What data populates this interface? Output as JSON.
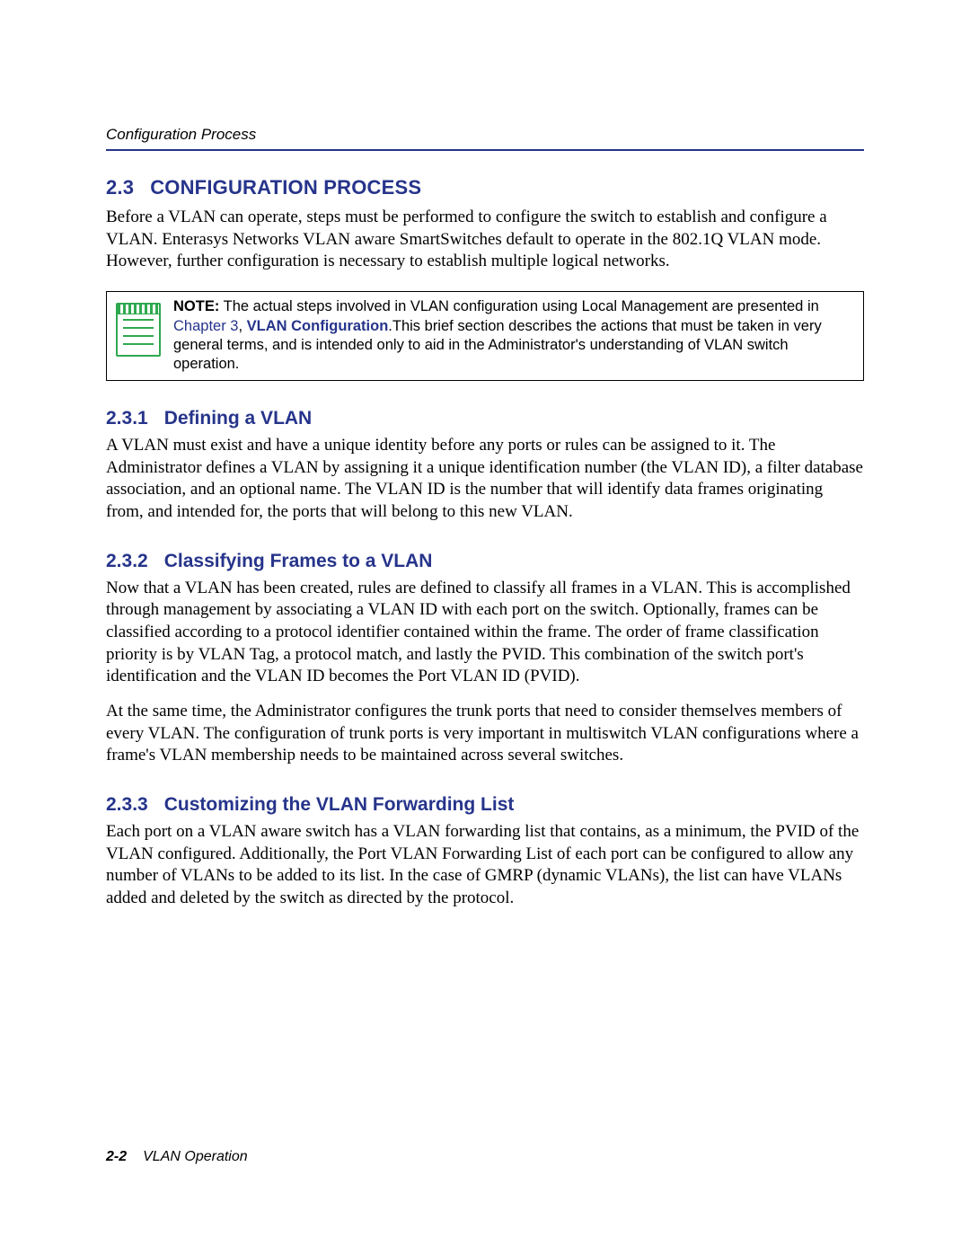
{
  "runningHead": "Configuration Process",
  "section": {
    "num": "2.3",
    "title": "CONFIGURATION PROCESS",
    "intro": "Before a VLAN can operate, steps must be performed to configure the switch to establish and configure a VLAN. Enterasys Networks VLAN aware SmartSwitches default to operate in the 802.1Q VLAN mode. However, further configuration is necessary to establish multiple logical networks."
  },
  "note": {
    "label": "NOTE:",
    "pre": " The actual steps involved in VLAN configuration using Local Management are presented in ",
    "link1": "Chapter 3",
    "sep": ", ",
    "link2": "VLAN Configuration",
    "post": ".This brief section describes the actions that must be taken in very general terms, and is intended only to aid in the Administrator's understanding of VLAN switch operation."
  },
  "sub1": {
    "num": "2.3.1",
    "title": "Defining a VLAN",
    "body": "A VLAN must exist and have a unique identity before any ports or rules can be assigned to it. The Administrator defines a VLAN by assigning it a unique identification number (the VLAN ID), a filter database association, and an optional name. The VLAN ID is the number that will identify data frames originating from, and intended for, the ports that will belong to this new VLAN."
  },
  "sub2": {
    "num": "2.3.2",
    "title": "Classifying Frames to a VLAN",
    "body1": "Now that a VLAN has been created, rules are defined to classify all frames in a VLAN. This is accomplished through management by associating a VLAN ID with each port on the switch. Optionally, frames can be classified according to a protocol identifier contained within the frame. The order of frame classification priority is by VLAN Tag, a protocol match, and lastly the PVID. This combination of the switch port's identification and the VLAN ID becomes the Port VLAN ID (PVID).",
    "body2": "At the same time, the Administrator configures the trunk ports that need to consider themselves members of every VLAN. The configuration of trunk ports is very important in multiswitch VLAN configurations where a frame's VLAN membership needs to be maintained across several switches."
  },
  "sub3": {
    "num": "2.3.3",
    "title": "Customizing the VLAN Forwarding List",
    "body": "Each port on a VLAN aware switch has a VLAN forwarding list that contains, as a minimum, the PVID of the VLAN configured. Additionally, the Port VLAN Forwarding List of each port can be configured to allow any number of VLANs to be added to its list. In the case of GMRP (dynamic VLANs), the list can have VLANs added and deleted by the switch as directed by the protocol."
  },
  "footer": {
    "page": "2-2",
    "chapter": "VLAN Operation"
  }
}
